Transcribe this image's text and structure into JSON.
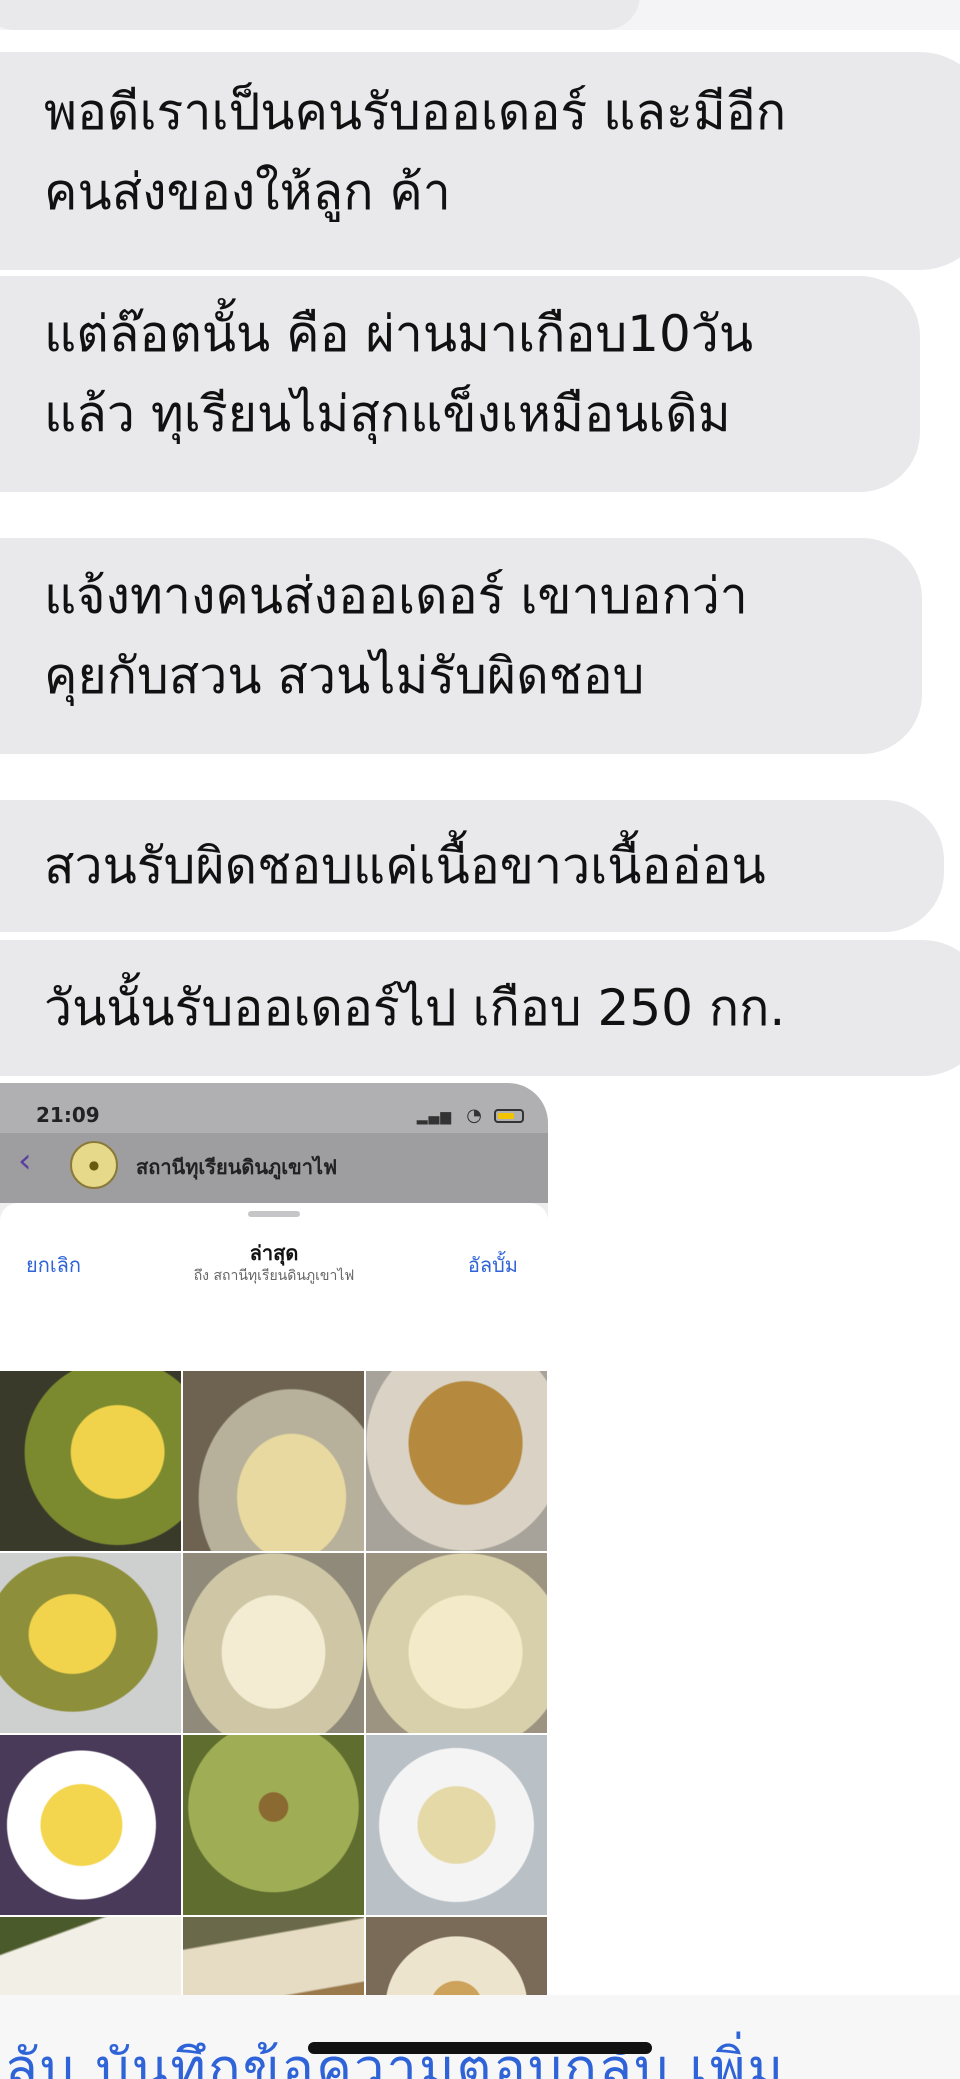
{
  "messages": [
    "พอดีเราเป็นคนรับออเดอร์ และมีอีก\nคนส่งของให้ลูก ค้า",
    "แต่ล๊อตนั้น คือ ผ่านมาเกือบ10วัน\nแล้ว ทุเรียนไม่สุกแข็งเหมือนเดิม",
    "แจ้งทางคนส่งออเดอร์ เขาบอกว่า\nคุยกับสวน สวนไม่รับผิดชอบ",
    "สวนรับผิดชอบแค่เนื้อขาวเนื้ออ่อน",
    "วันนั้นรับออเดอร์ไป เกือบ 250 กก."
  ],
  "attached_screenshot": {
    "status_time": "21:09",
    "chat_title": "สถานีทุเรียนดินภูเขาไฟ",
    "sheet": {
      "cancel_label": "ยกเลิก",
      "title": "ล่าสุด",
      "subtitle": "ถึง สถานีทุเรียนดินภูเขาไฟ",
      "album_label": "อัลบั้ม"
    },
    "photo_tiles": [
      "durian-cut-yellow",
      "durian-flesh-plate",
      "durian-husk-brown",
      "durian-half-yellow",
      "durian-white-flesh",
      "durian-pale-flesh",
      "durian-plate-yellow",
      "durian-whole-green",
      "durian-plate-circled",
      "durian-split-white",
      "durian-split-brown",
      "durian-rotten-flesh"
    ]
  },
  "bottom_actions_text": "กลับ   บันทึกข้อความตอบกลับ   เพิ่ม",
  "colors": {
    "bubble": "#e9e9eb",
    "link_blue": "#2f63d8"
  }
}
